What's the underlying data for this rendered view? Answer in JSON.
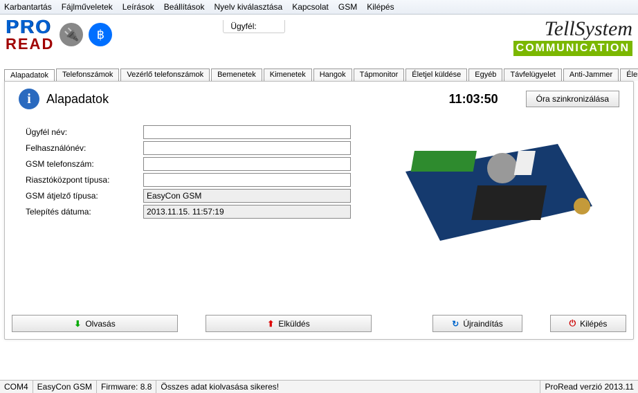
{
  "menu": [
    "Karbantartás",
    "Fájlműveletek",
    "Leírások",
    "Beállítások",
    "Nyelv kiválasztása",
    "Kapcsolat",
    "GSM",
    "Kilépés"
  ],
  "header": {
    "clientLabel": "Ügyfél:"
  },
  "logo": {
    "line1": "PRO",
    "line2": "READ",
    "tell1": "TellSystem",
    "tell2": "COMMUNICATION"
  },
  "tabs": [
    "Alapadatok",
    "Telefonszámok",
    "Vezérlő telefonszámok",
    "Bemenetek",
    "Kimenetek",
    "Hangok",
    "Tápmonitor",
    "Életjel küldése",
    "Egyéb",
    "Távfelügyelet",
    "Anti-Jammer",
    "Élesítés/hatástalanítás"
  ],
  "activeTab": 0,
  "page": {
    "title": "Alapadatok",
    "clock": "11:03:50",
    "syncBtn": "Óra szinkronizálása",
    "fields": {
      "clientName": {
        "label": "Ügyfél név:",
        "value": ""
      },
      "userName": {
        "label": "Felhasználónév:",
        "value": ""
      },
      "gsmPhone": {
        "label": "GSM telefonszám:",
        "value": ""
      },
      "alarmType": {
        "label": "Riasztóközpont típusa:",
        "value": ""
      },
      "gsmRelayType": {
        "label": "GSM átjelző típusa:",
        "value": "EasyCon GSM"
      },
      "installDate": {
        "label": "Telepítés dátuma:",
        "value": "2013.11.15. 11:57:19"
      }
    }
  },
  "buttons": {
    "read": "Olvasás",
    "send": "Elküldés",
    "restart": "Újraindítás",
    "exit": "Kilépés"
  },
  "status": {
    "port": "COM4",
    "device": "EasyCon GSM",
    "fw": "Firmware: 8.8",
    "msg": "Összes adat kiolvasása sikeres!",
    "ver": "ProRead verzió 2013.11"
  }
}
